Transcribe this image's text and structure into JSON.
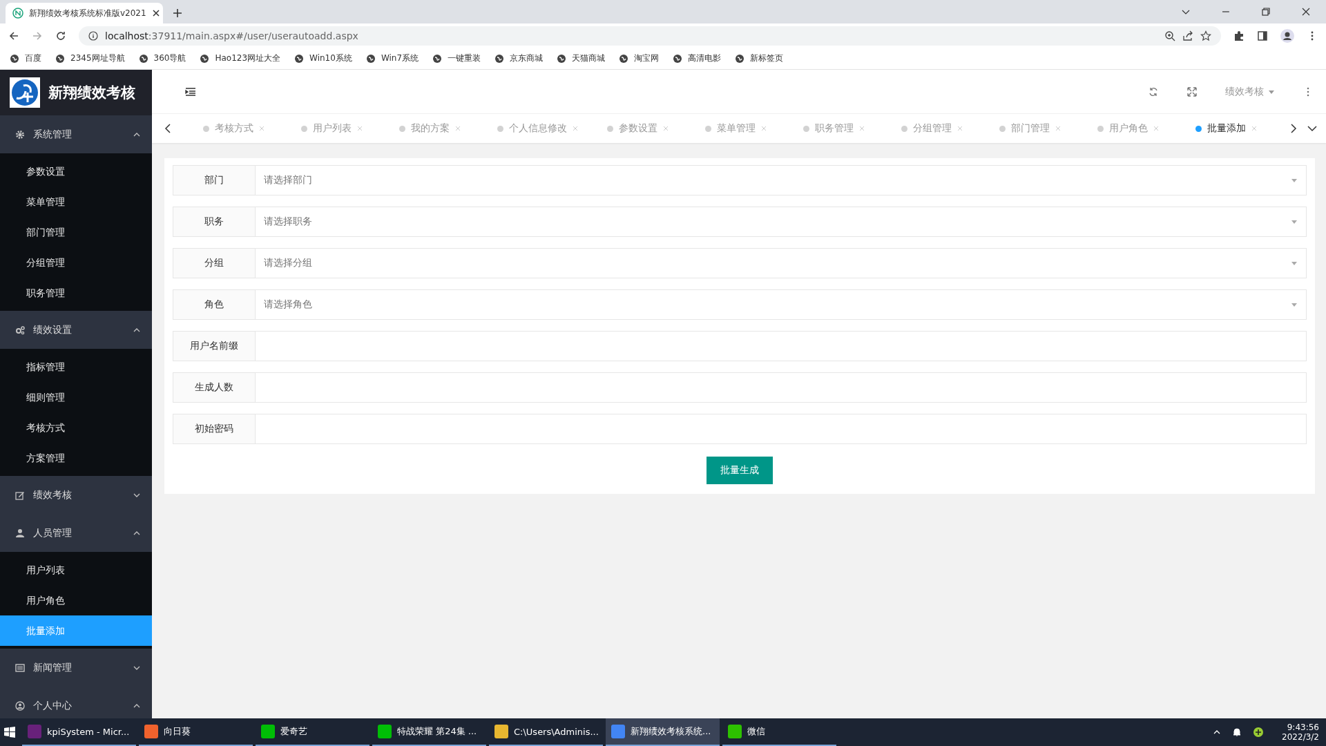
{
  "browser": {
    "tab_title": "新翔绩效考核系统标准版v2021",
    "url_host": "localhost",
    "url_rest": ":37911/main.aspx#/user/userautoadd.aspx",
    "bookmarks": [
      "百度",
      "2345网址导航",
      "360导航",
      "Hao123网址大全",
      "Win10系统",
      "Win7系统",
      "一键重装",
      "京东商城",
      "天猫商城",
      "淘宝网",
      "高清电影",
      "新标签页"
    ]
  },
  "app": {
    "logo_text": "新翔绩效考核",
    "header_menu": "绩效考核",
    "sidebar": [
      {
        "label": "系统管理",
        "expanded": true,
        "items": [
          {
            "label": "参数设置",
            "selected": false
          },
          {
            "label": "菜单管理",
            "selected": false
          },
          {
            "label": "部门管理",
            "selected": false
          },
          {
            "label": "分组管理",
            "selected": false
          },
          {
            "label": "职务管理",
            "selected": false
          }
        ]
      },
      {
        "label": "绩效设置",
        "expanded": true,
        "items": [
          {
            "label": "指标管理",
            "selected": false
          },
          {
            "label": "细则管理",
            "selected": false
          },
          {
            "label": "考核方式",
            "selected": false
          },
          {
            "label": "方案管理",
            "selected": false
          }
        ]
      },
      {
        "label": "绩效考核",
        "expanded": false
      },
      {
        "label": "人员管理",
        "expanded": true,
        "items": [
          {
            "label": "用户列表",
            "selected": false
          },
          {
            "label": "用户角色",
            "selected": false
          },
          {
            "label": "批量添加",
            "selected": true
          }
        ]
      },
      {
        "label": "新闻管理",
        "expanded": false
      },
      {
        "label": "个人中心",
        "expanded": true
      }
    ],
    "page_tabs": [
      {
        "label": "考核方式",
        "selected": false
      },
      {
        "label": "用户列表",
        "selected": false
      },
      {
        "label": "我的方案",
        "selected": false
      },
      {
        "label": "个人信息修改",
        "selected": false
      },
      {
        "label": "参数设置",
        "selected": false
      },
      {
        "label": "菜单管理",
        "selected": false
      },
      {
        "label": "职务管理",
        "selected": false
      },
      {
        "label": "分组管理",
        "selected": false
      },
      {
        "label": "部门管理",
        "selected": false
      },
      {
        "label": "用户角色",
        "selected": false
      },
      {
        "label": "批量添加",
        "selected": true
      }
    ],
    "form": {
      "fields": [
        {
          "label": "部门",
          "kind": "select",
          "placeholder": "请选择部门"
        },
        {
          "label": "职务",
          "kind": "select",
          "placeholder": "请选择职务"
        },
        {
          "label": "分组",
          "kind": "select",
          "placeholder": "请选择分组"
        },
        {
          "label": "角色",
          "kind": "select",
          "placeholder": "请选择角色"
        },
        {
          "label": "用户名前缀",
          "kind": "text"
        },
        {
          "label": "生成人数",
          "kind": "text"
        },
        {
          "label": "初始密码",
          "kind": "text"
        }
      ],
      "submit": "批量生成"
    }
  },
  "taskbar": {
    "apps": [
      {
        "label": "kpiSystem - Micr...",
        "selected": false
      },
      {
        "label": "向日葵",
        "selected": false
      },
      {
        "label": "爱奇艺",
        "selected": false
      },
      {
        "label": "特战荣耀 第24集 ...",
        "selected": false
      },
      {
        "label": "C:\\Users\\Adminis...",
        "selected": false
      },
      {
        "label": "新翔绩效考核系统...",
        "selected": true
      },
      {
        "label": "微信",
        "selected": false
      }
    ],
    "time": "9:43:56",
    "date": "2022/3/2"
  }
}
